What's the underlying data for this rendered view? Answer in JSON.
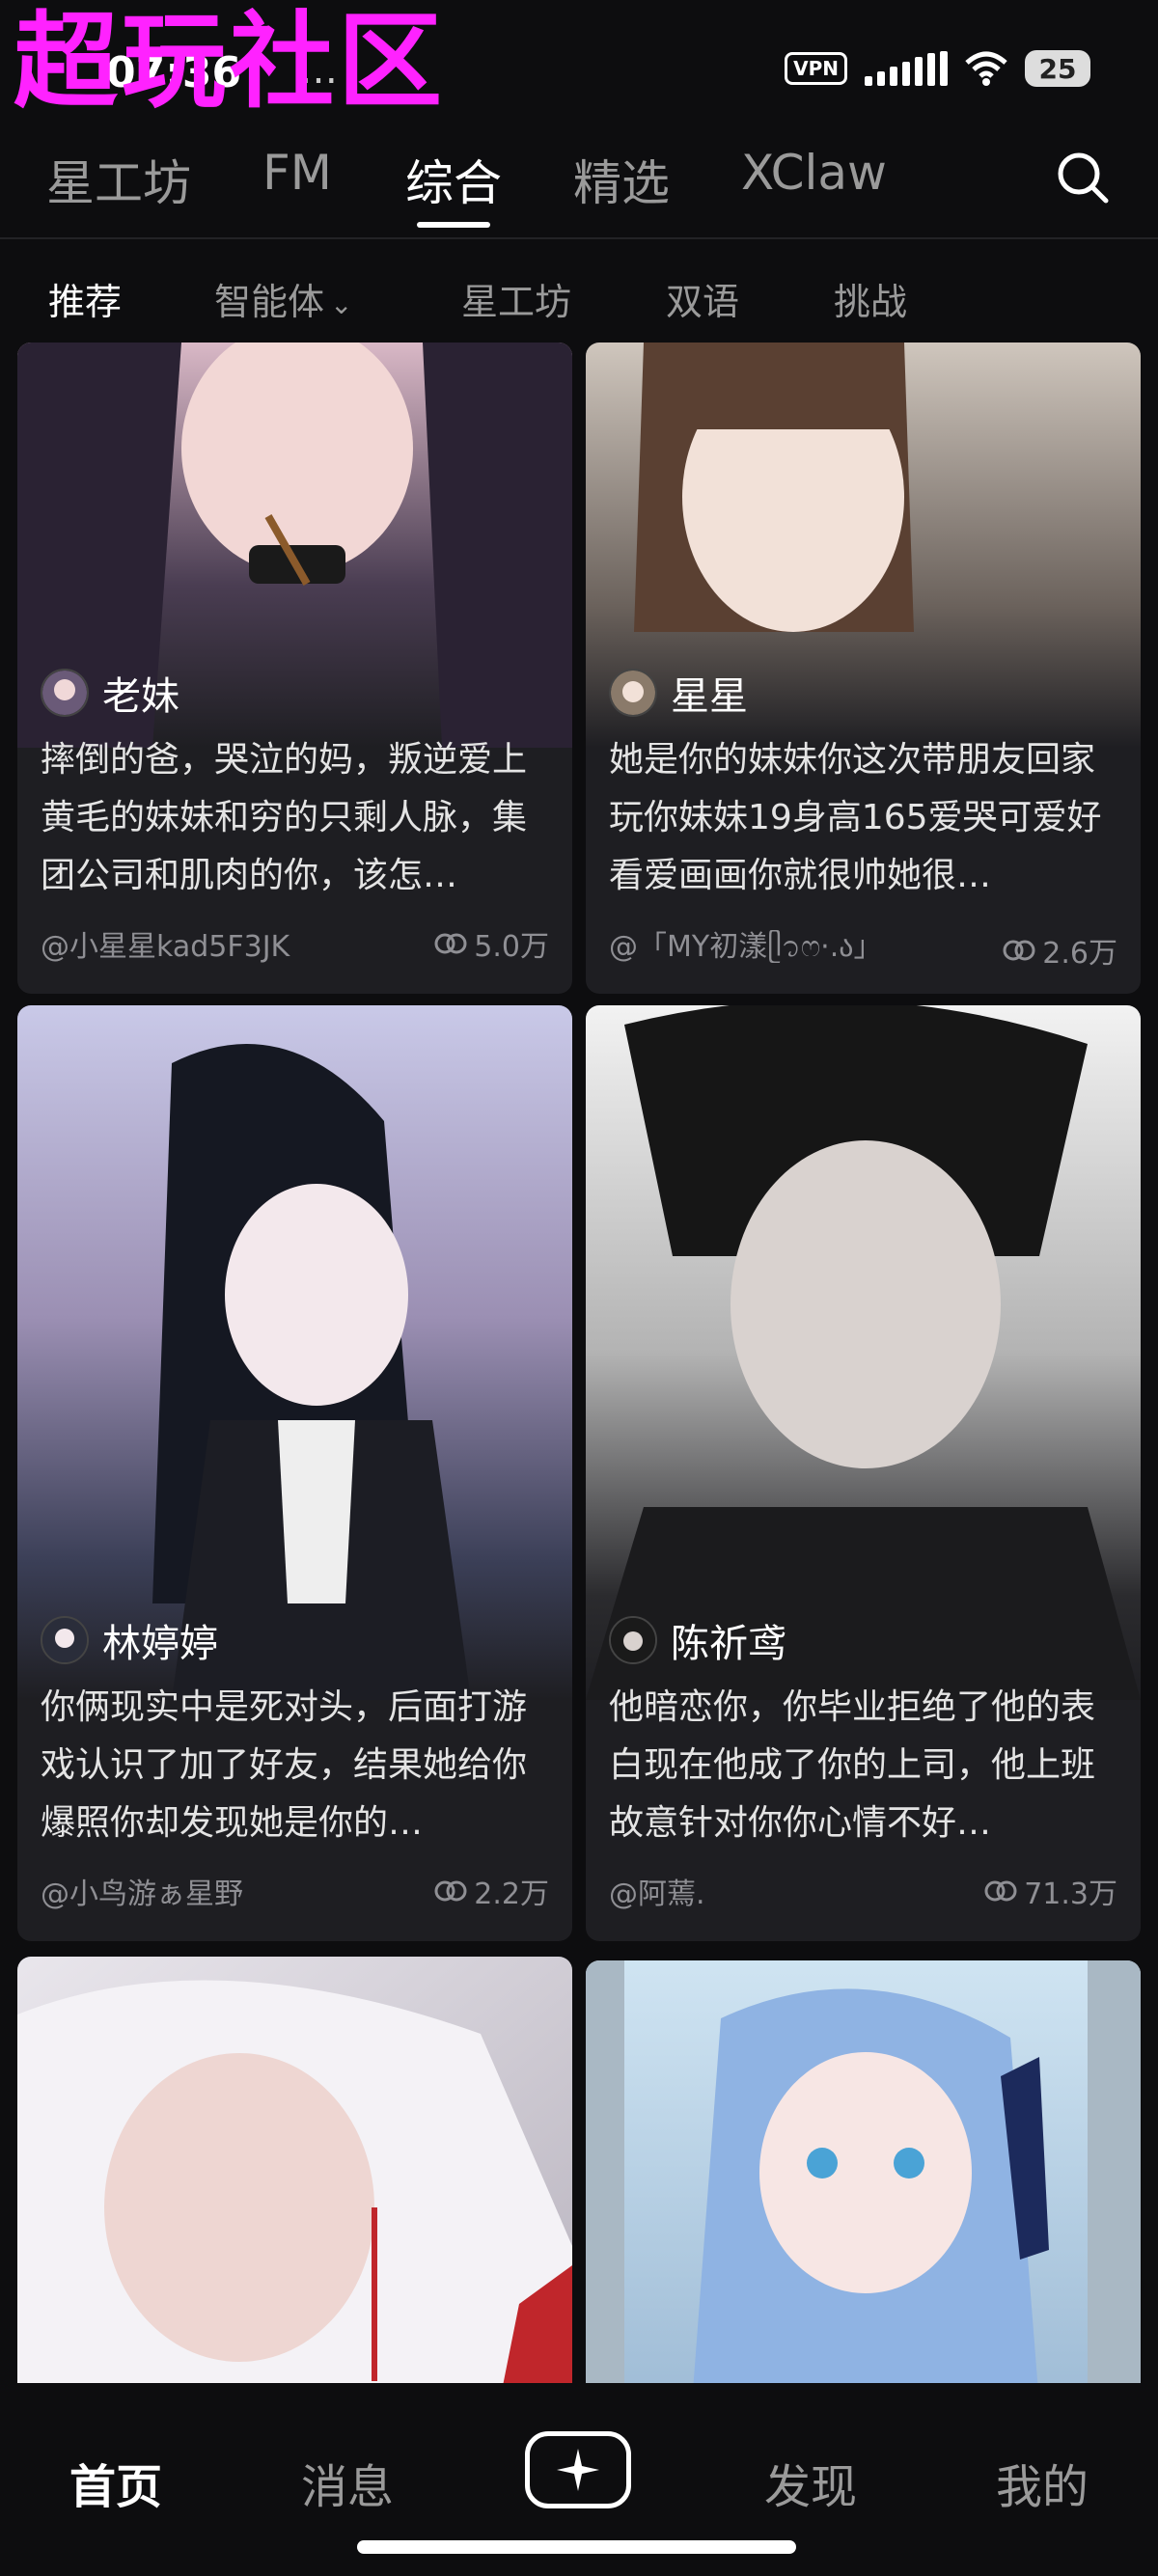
{
  "watermark": "超玩社区",
  "status": {
    "time": "07:36",
    "dots": "…",
    "vpn": "VPN",
    "battery": "25"
  },
  "top_tabs": [
    {
      "label": "星工坊"
    },
    {
      "label": "FM"
    },
    {
      "label": "综合",
      "active": true
    },
    {
      "label": "精选"
    },
    {
      "label": "XClaw"
    }
  ],
  "sub_tabs": [
    {
      "label": "推荐",
      "active": true
    },
    {
      "label": "智能体"
    },
    {
      "label": "星工坊"
    },
    {
      "label": "双语"
    },
    {
      "label": "挑战"
    }
  ],
  "cards": [
    {
      "name": "老妹",
      "desc": "摔倒的爸，哭泣的妈，叛逆爱上黄毛的妹妹和穷的只剩人脉，集团公司和肌肉的你，该怎…",
      "creator": "@小星星kad5F3JK",
      "count": "5.0万"
    },
    {
      "name": "星星",
      "desc": "她是你的妹妹你这次带朋友回家玩你妹妹19身高165爱哭可爱好看爱画画你就很帅她很…",
      "creator": "@「MY初漾ᥫ᭡ෆ·.ა」",
      "count": "2.6万"
    },
    {
      "name": "林婷婷",
      "desc": "你俩现实中是死对头，后面打游戏认识了加了好友，结果她给你爆照你却发现她是你的…",
      "creator": "@小鸟游ぁ星野",
      "count": "2.2万"
    },
    {
      "name": "陈祈鸢",
      "desc": "他暗恋你，你毕业拒绝了他的表白现在他成了你的上司，他上班故意针对你你心情不好…",
      "creator": "@阿蔫.",
      "count": "71.3万"
    }
  ],
  "bottom_nav": [
    {
      "label": "首页",
      "active": true
    },
    {
      "label": "消息"
    },
    {
      "label": "发现"
    },
    {
      "label": "我的"
    }
  ]
}
